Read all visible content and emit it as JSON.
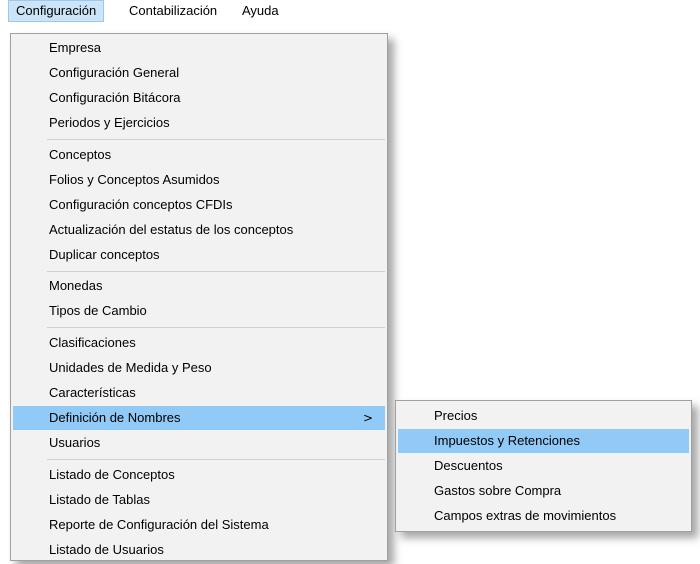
{
  "menubar": {
    "items": [
      {
        "label": "Configuración"
      },
      {
        "label": "Contabilización"
      },
      {
        "label": "Ayuda"
      }
    ]
  },
  "main_menu": {
    "items": [
      {
        "label": "Empresa"
      },
      {
        "label": "Configuración General"
      },
      {
        "label": "Configuración Bitácora"
      },
      {
        "label": "Periodos y Ejercicios"
      },
      {
        "label": "Conceptos"
      },
      {
        "label": "Folios y Conceptos Asumidos"
      },
      {
        "label": "Configuración conceptos CFDIs"
      },
      {
        "label": "Actualización del estatus de los conceptos"
      },
      {
        "label": "Duplicar conceptos"
      },
      {
        "label": "Monedas"
      },
      {
        "label": "Tipos de Cambio"
      },
      {
        "label": "Clasificaciones"
      },
      {
        "label": "Unidades de Medida y Peso"
      },
      {
        "label": "Características"
      },
      {
        "label": "Definición de Nombres",
        "submenu_arrow": ">"
      },
      {
        "label": "Usuarios"
      },
      {
        "label": "Listado de Conceptos"
      },
      {
        "label": "Listado de Tablas"
      },
      {
        "label": "Reporte de Configuración del Sistema"
      },
      {
        "label": "Listado de Usuarios"
      }
    ]
  },
  "submenu": {
    "items": [
      {
        "label": "Precios"
      },
      {
        "label": "Impuestos y Retenciones"
      },
      {
        "label": "Descuentos"
      },
      {
        "label": "Gastos sobre Compra"
      },
      {
        "label": "Campos extras de movimientos"
      }
    ]
  },
  "colors": {
    "menu_background": "#f2f2f2",
    "highlight": "#91c9f7",
    "menubar_active": "#cce4f7"
  }
}
